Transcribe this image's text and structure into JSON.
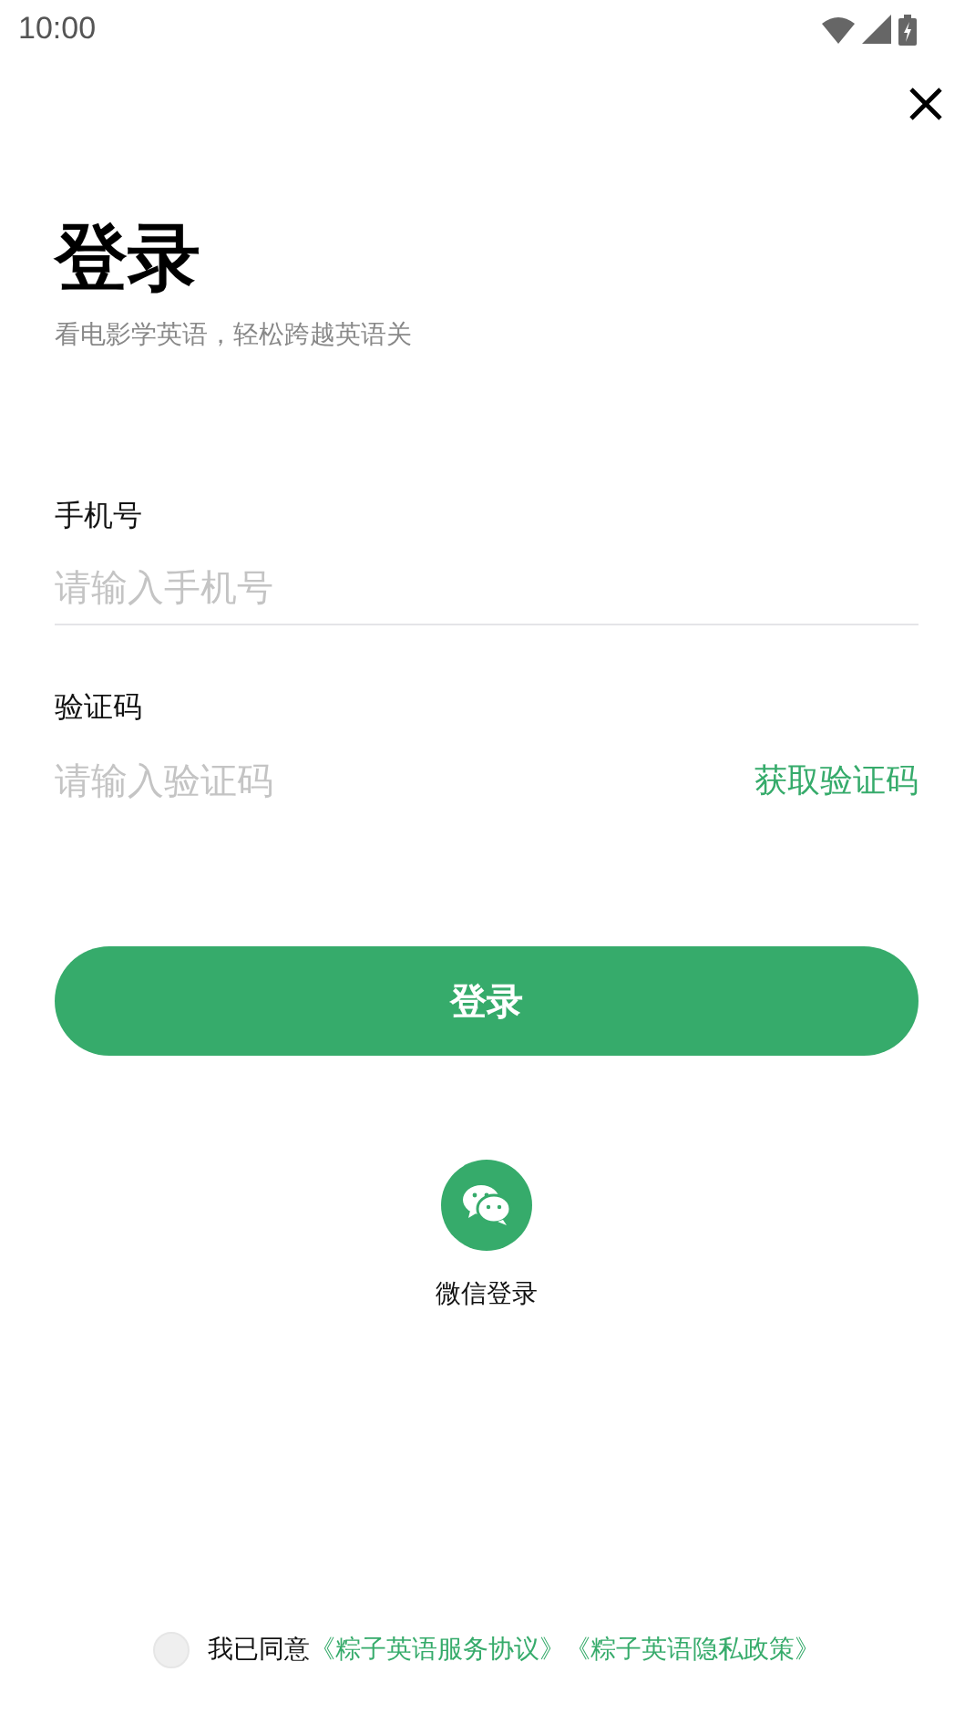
{
  "status_bar": {
    "time": "10:00"
  },
  "title": "登录",
  "subtitle": "看电影学英语，轻松跨越英语关",
  "fields": [
    {
      "kind": "phone",
      "label": "手机号",
      "placeholder": "请输入手机号"
    },
    {
      "kind": "code",
      "label": "验证码",
      "placeholder": "请输入验证码",
      "action": "获取验证码"
    }
  ],
  "login_button": "登录",
  "wechat_login": {
    "label": "微信登录"
  },
  "agreement": {
    "checked": false,
    "text": "我已同意",
    "links": [
      "《粽子英语服务协议》",
      "《粽子英语隐私政策》"
    ]
  }
}
